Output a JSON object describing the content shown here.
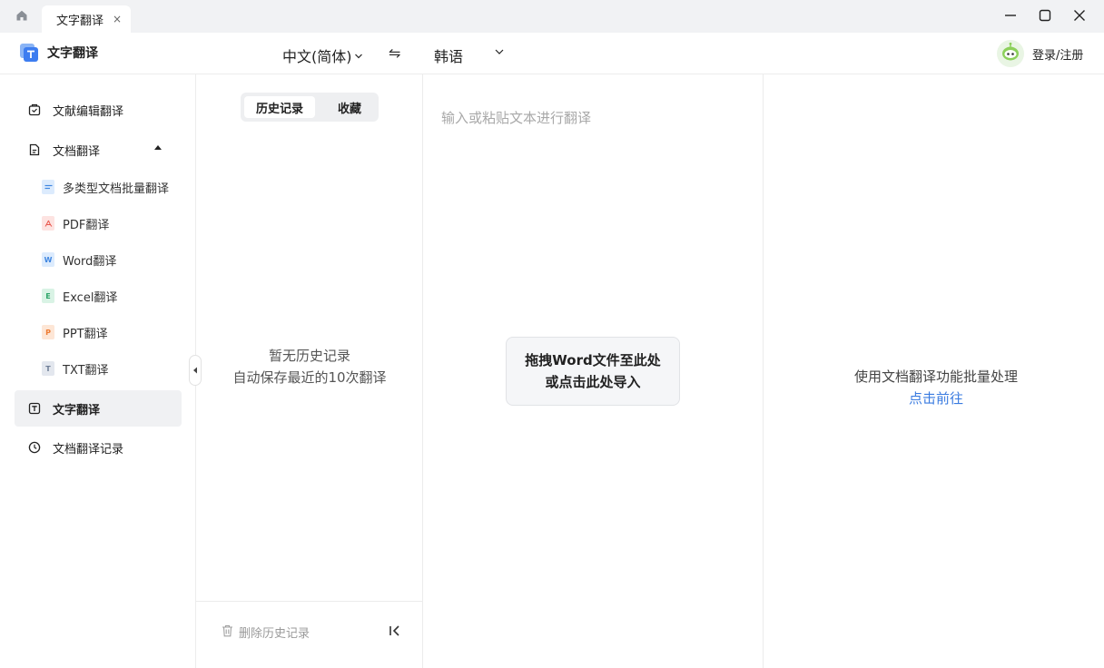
{
  "titlebar": {
    "tab_title": "文字翻译",
    "tab_close": "×"
  },
  "header": {
    "app_name": "文字翻译",
    "source_lang": "中文(简体)",
    "swap_symbol": "⇋",
    "target_lang": "韩语",
    "login_label": "登录/注册"
  },
  "sidebar": {
    "items": [
      {
        "label": "文献编辑翻译",
        "icon": "document-edit-icon"
      },
      {
        "label": "文档翻译",
        "icon": "document-icon",
        "expanded": true
      },
      {
        "label": "文字翻译",
        "icon": "text-translate-icon",
        "active": true
      },
      {
        "label": "文档翻译记录",
        "icon": "clock-icon"
      }
    ],
    "sub_items": [
      {
        "label": "多类型文档批量翻译",
        "badge": "",
        "color": "#5aa0f0"
      },
      {
        "label": "PDF翻译",
        "badge": "",
        "color": "#e8574d"
      },
      {
        "label": "Word翻译",
        "badge": "W",
        "color": "#3f86e0"
      },
      {
        "label": "Excel翻译",
        "badge": "E",
        "color": "#2ea56a"
      },
      {
        "label": "PPT翻译",
        "badge": "P",
        "color": "#ee7b33"
      },
      {
        "label": "TXT翻译",
        "badge": "T",
        "color": "#6d7d96"
      }
    ]
  },
  "history": {
    "tab_history": "历史记录",
    "tab_favorites": "收藏",
    "empty_title": "暂无历史记录",
    "empty_subtitle": "自动保存最近的10次翻译",
    "delete_label": "删除历史记录"
  },
  "input": {
    "placeholder": "输入或粘贴文本进行翻译",
    "drop_line1": "拖拽Word文件至此处",
    "drop_line2": "或点击此处导入"
  },
  "output": {
    "hint": "使用文档翻译功能批量处理",
    "link": "点击前往"
  },
  "colors": {
    "accent_link": "#3a7be0",
    "active_bg": "#f0f1f3",
    "titlebar_bg": "#f1f2f4"
  }
}
